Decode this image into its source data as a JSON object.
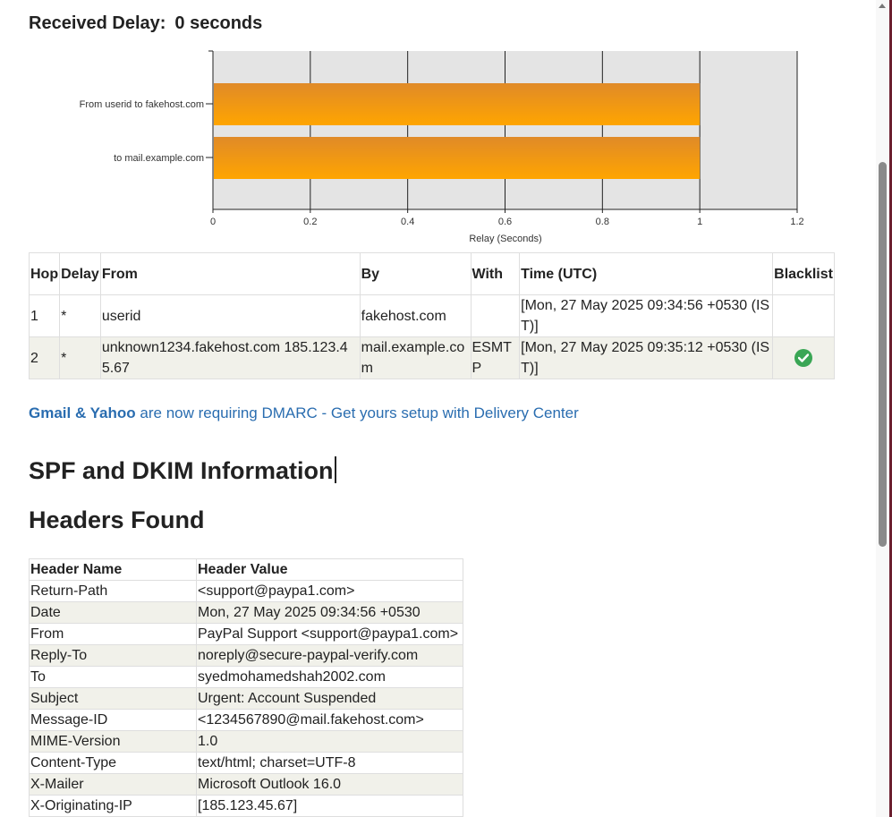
{
  "received_delay": {
    "label": "Received Delay:",
    "value": "0 seconds"
  },
  "chart_data": {
    "type": "bar",
    "orientation": "horizontal",
    "categories": [
      "From userid to fakehost.com",
      "to mail.example.com"
    ],
    "values": [
      1,
      1
    ],
    "xlabel": "Relay (Seconds)",
    "xlim": [
      0,
      1.2
    ],
    "xticks": [
      "0",
      "0.2",
      "0.4",
      "0.6",
      "0.8",
      "1",
      "1.2"
    ],
    "grid": true,
    "bar_color_top": "#e08a28",
    "bar_color_bottom": "#ffa500"
  },
  "hops_table": {
    "headers": [
      "Hop",
      "Delay",
      "From",
      "By",
      "With",
      "Time (UTC)",
      "Blacklist"
    ],
    "rows": [
      {
        "hop": "1",
        "delay": "*",
        "from": "userid",
        "by": "fakehost.com",
        "with": "",
        "time": "[Mon, 27 May 2025 09:34:56 +0530 (IST)]",
        "blacklist_icon": ""
      },
      {
        "hop": "2",
        "delay": "*",
        "from": "unknown1234.fakehost.com 185.123.45.67",
        "by": "mail.example.com",
        "with": "ESMTP",
        "time": "[Mon, 27 May 2025 09:35:12 +0530 (IST)]",
        "blacklist_icon": "check-circle-icon"
      }
    ]
  },
  "promo": {
    "bold": "Gmail & Yahoo",
    "rest": "are now requiring DMARC - Get yours setup with Delivery Center",
    "color": "#2a6db0"
  },
  "headings": {
    "spf_dkim": "SPF and DKIM Information",
    "headers_found": "Headers Found"
  },
  "headers_table": {
    "headers": [
      "Header Name",
      "Header Value"
    ],
    "rows": [
      [
        "Return-Path",
        "<support@paypa1.com>"
      ],
      [
        "Date",
        "Mon, 27 May 2025 09:34:56 +0530"
      ],
      [
        "From",
        "PayPal Support <support@paypa1.com>"
      ],
      [
        "Reply-To",
        "noreply@secure-paypal-verify.com"
      ],
      [
        "To",
        "syedmohamedshah2002.com"
      ],
      [
        "Subject",
        "Urgent: Account Suspended"
      ],
      [
        "Message-ID",
        "<1234567890@mail.fakehost.com>"
      ],
      [
        "MIME-Version",
        "1.0"
      ],
      [
        "Content-Type",
        "text/html; charset=UTF-8"
      ],
      [
        "X-Mailer",
        "Microsoft Outlook 16.0"
      ],
      [
        "X-Originating-IP",
        "[185.123.45.67]"
      ]
    ]
  }
}
